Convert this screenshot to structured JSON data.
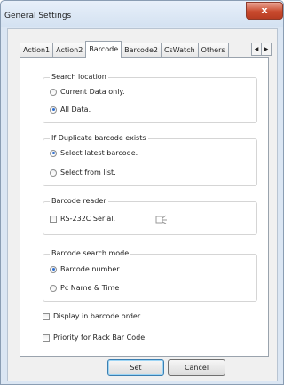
{
  "window": {
    "title": "General Settings",
    "close_label": "x"
  },
  "tabs": [
    {
      "label": "Action1",
      "active": false
    },
    {
      "label": "Action2",
      "active": false
    },
    {
      "label": "Barcode",
      "active": true
    },
    {
      "label": "Barcode2",
      "active": false
    },
    {
      "label": "CsWatch",
      "active": false
    },
    {
      "label": "Others",
      "active": false
    }
  ],
  "tab_scroll": {
    "left": "◀",
    "right": "▶"
  },
  "search_location": {
    "legend": "Search location",
    "options": [
      {
        "label": "Current Data only.",
        "selected": false
      },
      {
        "label": "All Data.",
        "selected": true
      }
    ]
  },
  "duplicate": {
    "legend": "If Duplicate barcode exists",
    "options": [
      {
        "label": "Select latest barcode.",
        "selected": true
      },
      {
        "label": "Select from list.",
        "selected": false
      }
    ]
  },
  "reader": {
    "legend": "Barcode reader",
    "serial_label": "RS-232C Serial.",
    "serial_checked": false,
    "icon": "barcode-reader-icon"
  },
  "search_mode": {
    "legend": "Barcode search mode",
    "options": [
      {
        "label": "Barcode number",
        "selected": true
      },
      {
        "label": "Pc Name & Time",
        "selected": false
      }
    ]
  },
  "checkboxes": [
    {
      "label": "Display in barcode order.",
      "checked": false
    },
    {
      "label": "Priority for Rack Bar Code.",
      "checked": false
    }
  ],
  "buttons": {
    "set": "Set",
    "cancel": "Cancel"
  }
}
